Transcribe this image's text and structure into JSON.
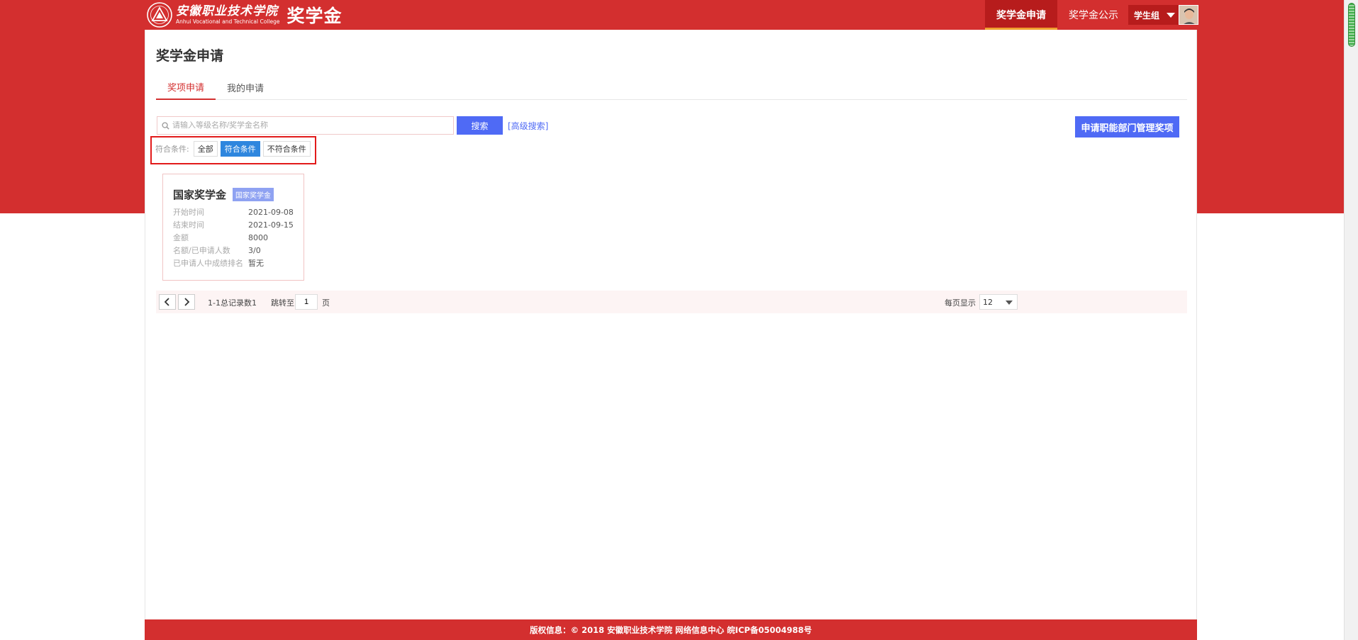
{
  "header": {
    "logo_cn": "安徽职业技术学院",
    "logo_en": "Anhui Vocational and Technical College",
    "app_title": "奖学金",
    "nav": [
      {
        "label": "奖学金申请",
        "active": true
      },
      {
        "label": "奖学金公示",
        "active": false
      }
    ],
    "user_role": "学生组"
  },
  "page": {
    "title": "奖学金申请",
    "tabs": [
      {
        "label": "奖项申请",
        "active": true
      },
      {
        "label": "我的申请",
        "active": false
      }
    ]
  },
  "search": {
    "placeholder": "请输入等级名称/奖学金名称",
    "value": "",
    "button_label": "搜索",
    "advanced_label": "[高级搜索]"
  },
  "apply_dept_button": "申请职能部门管理奖项",
  "filter": {
    "label": "符合条件:",
    "options": [
      {
        "label": "全部",
        "selected": false
      },
      {
        "label": "符合条件",
        "selected": true
      },
      {
        "label": "不符合条件",
        "selected": false
      }
    ]
  },
  "cards": [
    {
      "title": "国家奖学金",
      "tag": "国家奖学金",
      "fields": [
        {
          "label": "开始时间",
          "value": "2021-09-08"
        },
        {
          "label": "结束时间",
          "value": "2021-09-15"
        },
        {
          "label": "金额",
          "value": "8000"
        },
        {
          "label": "名额/已申请人数",
          "value": "3/0"
        },
        {
          "label": "已申请人中成绩排名",
          "value": "暂无"
        }
      ]
    }
  ],
  "pagination": {
    "summary": "1-1总记录数1",
    "jump_label": "跳转至",
    "current_page": "1",
    "page_unit": "页",
    "per_page_label": "每页显示",
    "per_page": "12"
  },
  "footer": "版权信息：© 2018 安徽职业技术学院 网络信息中心 皖ICP备05004988号",
  "colors": {
    "brand_red": "#d32f2f",
    "accent_blue": "#4f6af5",
    "chip_selected": "#2e86de",
    "highlight_box": "#e21a1a"
  }
}
